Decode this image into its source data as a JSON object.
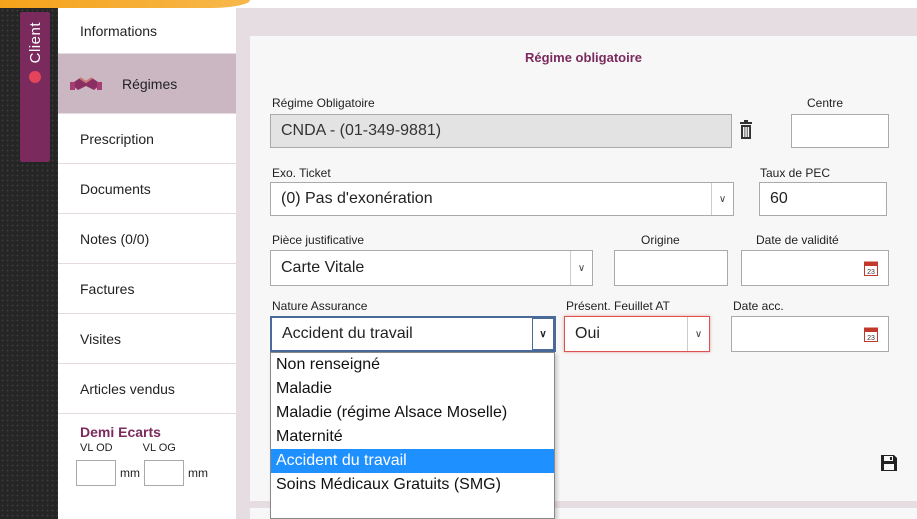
{
  "client_tab": {
    "label": "Client"
  },
  "sidebar": {
    "items": [
      {
        "label": "Informations"
      },
      {
        "label": "Régimes"
      },
      {
        "label": "Prescription"
      },
      {
        "label": "Documents"
      },
      {
        "label": "Notes (0/0)"
      },
      {
        "label": "Factures"
      },
      {
        "label": "Visites"
      },
      {
        "label": "Articles vendus"
      }
    ],
    "demi_ecarts": {
      "title": "Demi Ecarts",
      "vl_od": "VL OD",
      "vl_og": "VL OG",
      "unit": "mm",
      "od_value": "",
      "og_value": ""
    }
  },
  "form": {
    "title": "Régime obligatoire",
    "regime_obligatoire": {
      "label": "Régime Obligatoire",
      "value": "CNDA - (01-349-9881)"
    },
    "centre": {
      "label": "Centre",
      "value": ""
    },
    "exo_ticket": {
      "label": "Exo. Ticket",
      "value": "(0) Pas d'exonération"
    },
    "taux_pec": {
      "label": "Taux de PEC",
      "value": "60"
    },
    "piece_justificative": {
      "label": "Pièce justificative",
      "value": "Carte Vitale"
    },
    "origine": {
      "label": "Origine",
      "value": ""
    },
    "date_validite": {
      "label": "Date de validité",
      "value": ""
    },
    "nature_assurance": {
      "label": "Nature Assurance",
      "value": "Accident du travail",
      "options": [
        "Non renseigné",
        "Maladie",
        "Maladie (régime Alsace Moselle)",
        "Maternité",
        "Accident du travail",
        "Soins Médicaux Gratuits (SMG)"
      ],
      "selected_option": "Accident du travail"
    },
    "present_feuillet_at": {
      "label": "Présent. Feuillet AT",
      "value": "Oui"
    },
    "date_acc": {
      "label": "Date acc.",
      "value": ""
    }
  },
  "colors": {
    "accent": "#7b2a5e",
    "sidebar_active": "#cbb7c2",
    "content_bg": "#e6dde3",
    "select_highlight": "#1e90ff"
  }
}
